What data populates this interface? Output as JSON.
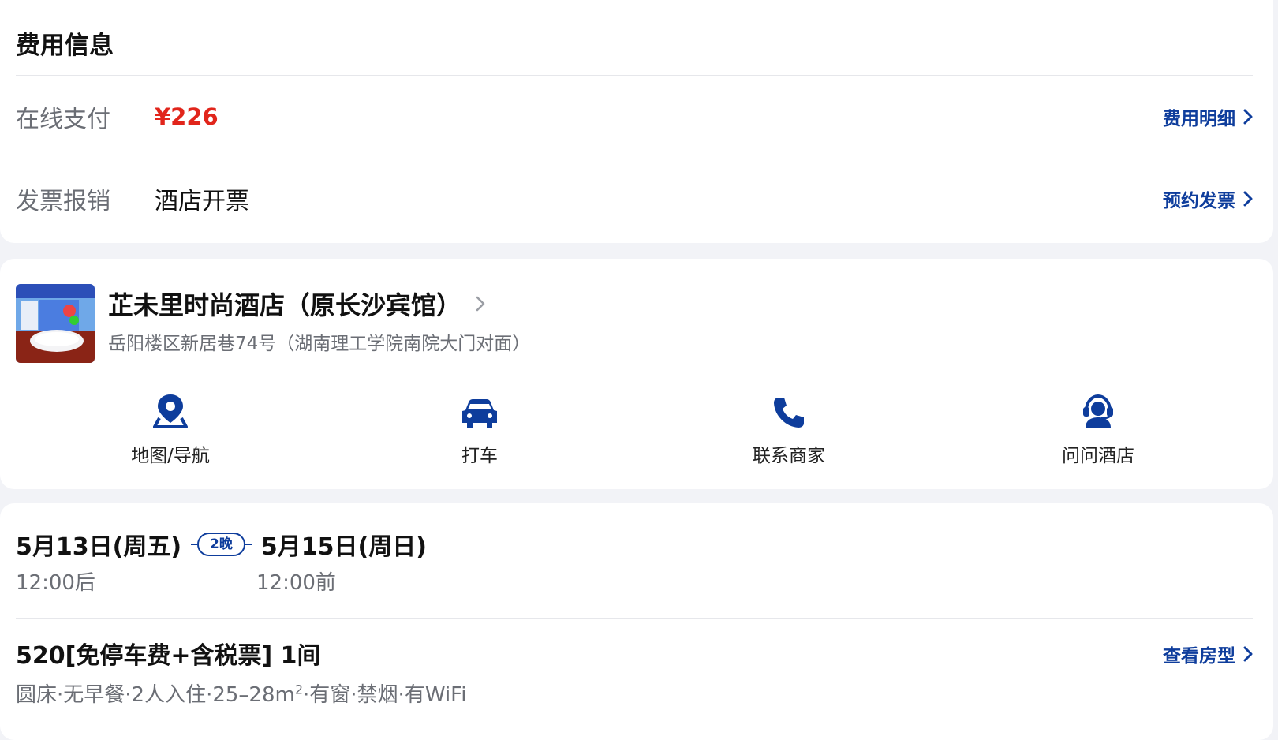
{
  "fee": {
    "title": "费用信息",
    "online_payment": {
      "label": "在线支付",
      "value": "¥226",
      "link": "费用明细"
    },
    "invoice": {
      "label": "发票报销",
      "value": "酒店开票",
      "link": "预约发票"
    }
  },
  "hotel": {
    "name": "芷未里时尚酒店（原长沙宾馆）",
    "address": "岳阳楼区新居巷74号（湖南理工学院南院大门对面）",
    "actions": [
      {
        "label": "地图/导航",
        "icon": "map-pin-icon"
      },
      {
        "label": "打车",
        "icon": "car-icon"
      },
      {
        "label": "联系商家",
        "icon": "phone-icon"
      },
      {
        "label": "问问酒店",
        "icon": "customer-service-icon"
      }
    ]
  },
  "stay": {
    "checkin_date": "5月13日(周五)",
    "checkin_time": "12:00后",
    "nights": "2晚",
    "checkout_date": "5月15日(周日)",
    "checkout_time": "12:00前",
    "room_title": "520[免停车费+含税票] 1间",
    "room_link": "查看房型",
    "room_desc_prefix": "圆床·无早餐·2人入住·25–28m",
    "room_desc_sup": "2",
    "room_desc_suffix": "·有窗·禁烟·有WiFi"
  },
  "colors": {
    "accent": "#0e3d9c",
    "price": "#e1251b",
    "background": "#f2f3f7"
  }
}
